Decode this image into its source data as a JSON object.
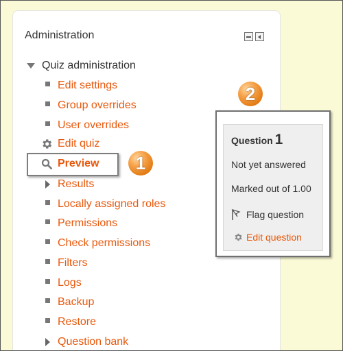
{
  "block": {
    "title": "Administration",
    "icons": [
      "minimize-icon",
      "dock-icon"
    ]
  },
  "tree": {
    "root_label": "Quiz administration",
    "items": [
      {
        "label": "Edit settings",
        "icon": "bullet"
      },
      {
        "label": "Group overrides",
        "icon": "bullet"
      },
      {
        "label": "User overrides",
        "icon": "bullet"
      },
      {
        "label": "Edit quiz",
        "icon": "gear-icon"
      },
      {
        "label": "Preview",
        "icon": "magnifier-icon"
      },
      {
        "label": "Results",
        "icon": "caret-right-icon"
      },
      {
        "label": "Locally assigned roles",
        "icon": "bullet"
      },
      {
        "label": "Permissions",
        "icon": "bullet"
      },
      {
        "label": "Check permissions",
        "icon": "bullet"
      },
      {
        "label": "Filters",
        "icon": "bullet"
      },
      {
        "label": "Logs",
        "icon": "bullet"
      },
      {
        "label": "Backup",
        "icon": "bullet"
      },
      {
        "label": "Restore",
        "icon": "bullet"
      },
      {
        "label": "Question bank",
        "icon": "caret-right-icon"
      }
    ]
  },
  "badges": {
    "one": "1",
    "two": "2"
  },
  "question_panel": {
    "title": "Question",
    "number": "1",
    "status": "Not yet answered",
    "marks": "Marked out of 1.00",
    "flag_label": "Flag question",
    "edit_label": "Edit question"
  },
  "colors": {
    "link": "#e8580c",
    "background": "#fafad6",
    "badge": "#f29a3a"
  }
}
